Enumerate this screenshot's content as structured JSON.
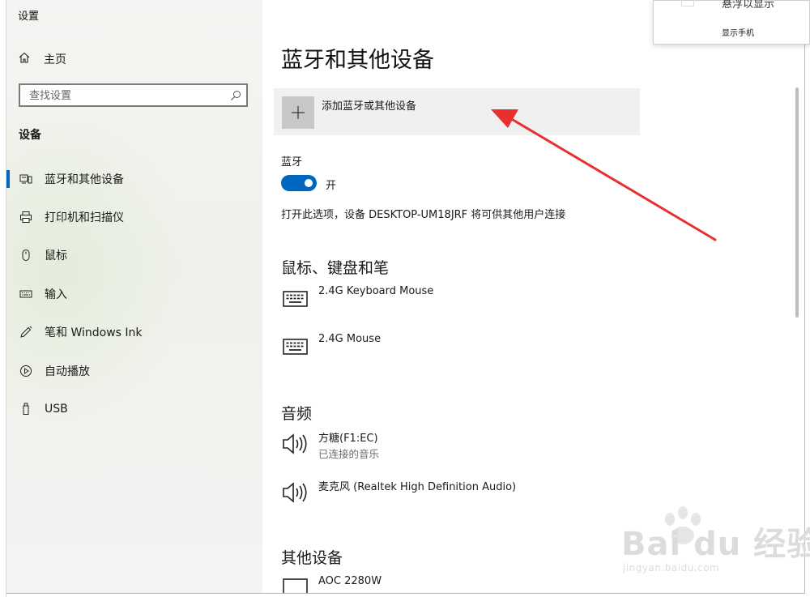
{
  "window": {
    "title": "设置"
  },
  "sidebar": {
    "home_label": "主页",
    "search_placeholder": "查找设置",
    "section_title": "设备",
    "items": [
      {
        "label": "蓝牙和其他设备",
        "icon": "bluetooth-devices-icon",
        "active": true
      },
      {
        "label": "打印机和扫描仪",
        "icon": "printer-icon"
      },
      {
        "label": "鼠标",
        "icon": "mouse-icon"
      },
      {
        "label": "输入",
        "icon": "keyboard-icon"
      },
      {
        "label": "笔和 Windows Ink",
        "icon": "pen-icon"
      },
      {
        "label": "自动播放",
        "icon": "autoplay-icon"
      },
      {
        "label": "USB",
        "icon": "usb-icon"
      }
    ]
  },
  "main": {
    "title": "蓝牙和其他设备",
    "add_device_label": "添加蓝牙或其他设备",
    "bluetooth": {
      "label": "蓝牙",
      "state": "开",
      "on": true,
      "discoverable_text": "打开此选项，设备 DESKTOP-UM18JRF 将可供其他用户连接"
    },
    "mouse_section": {
      "title": "鼠标、键盘和笔",
      "devices": [
        {
          "name": "2.4G Keyboard Mouse",
          "icon": "keyboard-icon"
        },
        {
          "name": "2.4G Mouse",
          "icon": "keyboard-icon"
        }
      ]
    },
    "audio_section": {
      "title": "音频",
      "devices": [
        {
          "name": "方糖(F1:EC)",
          "status": "已连接的音乐",
          "icon": "speaker-icon"
        },
        {
          "name": "麦克风 (Realtek High Definition Audio)",
          "icon": "speaker-icon"
        }
      ]
    },
    "other_section": {
      "title": "其他设备",
      "devices": [
        {
          "name": "AOC 2280W",
          "icon": "monitor-icon"
        }
      ]
    }
  },
  "popup": {
    "line1": "悬浮以显示",
    "line2": "显示手机"
  },
  "watermark": {
    "main": "Bai du 经验",
    "sub": "jingyan.baidu.com"
  },
  "colors": {
    "accent": "#0067c0",
    "annotation_arrow": "#e8312f"
  }
}
